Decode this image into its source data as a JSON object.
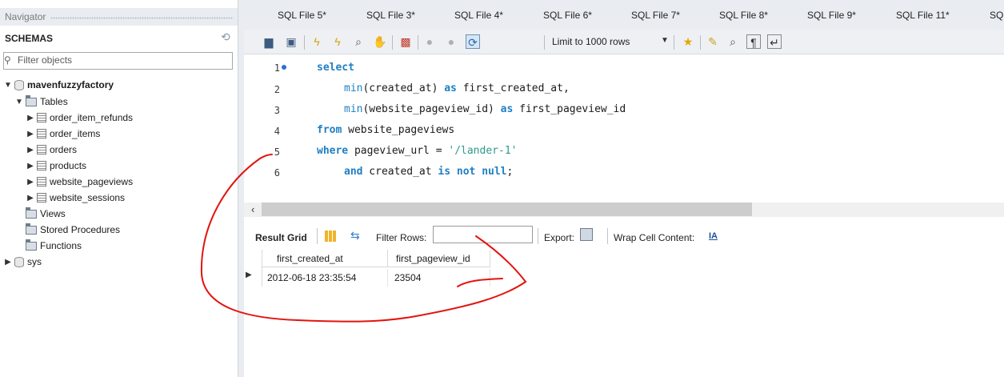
{
  "navigator": {
    "title": "Navigator",
    "schemas_label": "SCHEMAS",
    "filter_placeholder": "Filter objects",
    "schema_main": "mavenfuzzyfactory",
    "tables_label": "Tables",
    "tables": [
      "order_item_refunds",
      "order_items",
      "orders",
      "products",
      "website_pageviews",
      "website_sessions"
    ],
    "views_label": "Views",
    "procs_label": "Stored Procedures",
    "functions_label": "Functions",
    "schema_sys": "sys"
  },
  "tabs": [
    "SQL File 5*",
    "SQL File 3*",
    "SQL File 4*",
    "SQL File 6*",
    "SQL File 7*",
    "SQL File 8*",
    "SQL File 9*",
    "SQL File 11*",
    "SQ"
  ],
  "toolbar": {
    "limit_label": "Limit to 1000 rows"
  },
  "editor": {
    "line_numbers": [
      "1",
      "2",
      "3",
      "4",
      "5",
      "6"
    ],
    "lines": {
      "l1_kw": "select",
      "l2_fn": "min",
      "l2_rest": "(created_at) ",
      "l2_as": "as",
      "l2_alias": " first_created_at,",
      "l3_fn": "min",
      "l3_rest": "(website_pageview_id) ",
      "l3_as": "as",
      "l3_alias": " first_pageview_id",
      "l4_kw": "from",
      "l4_rest": " website_pageviews",
      "l5_kw": "where",
      "l5_rest": " pageview_url = ",
      "l5_str": "'/lander-1'",
      "l6_kw1": "and",
      "l6_rest": " created_at ",
      "l6_kw2": "is not null",
      "l6_end": ";"
    }
  },
  "result": {
    "grid_label": "Result Grid",
    "filter_rows_label": "Filter Rows:",
    "export_label": "Export:",
    "wrap_label": "Wrap Cell Content:",
    "wrap_icon_text": "IA",
    "columns": [
      "first_created_at",
      "first_pageview_id"
    ],
    "rows": [
      [
        "2012-06-18 23:35:54",
        "23504"
      ]
    ]
  },
  "colors": {
    "keyword": "#1f7fc4",
    "string": "#2e9a8d",
    "annotation": "#e3140f"
  }
}
